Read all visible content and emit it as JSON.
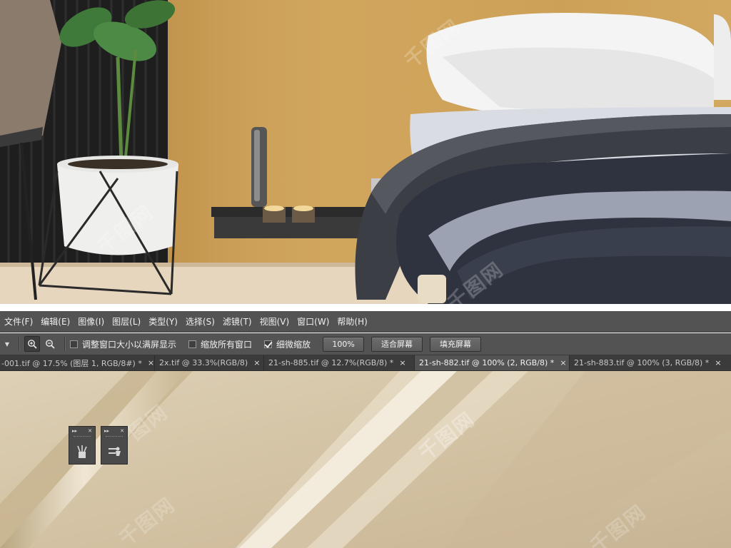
{
  "menu": [
    "文件(F)",
    "编辑(E)",
    "图像(I)",
    "图层(L)",
    "类型(Y)",
    "选择(S)",
    "滤镜(T)",
    "视图(V)",
    "窗口(W)",
    "帮助(H)"
  ],
  "options": {
    "resize_windows_label": "调整窗口大小以满屏显示",
    "resize_windows_checked": false,
    "zoom_all_label": "缩放所有窗口",
    "zoom_all_checked": false,
    "scrubby_zoom_label": "细微缩放",
    "scrubby_zoom_checked": true,
    "percent_button": "100%",
    "fit_screen_button": "适合屏幕",
    "fill_screen_button": "填充屏幕"
  },
  "tabs": [
    {
      "title": "-001.tif @ 17.5% (图层 1, RGB/8#) *",
      "active": false
    },
    {
      "title": "2x.tif @ 33.3%(RGB/8)",
      "active": false
    },
    {
      "title": "21-sh-885.tif @ 12.7%(RGB/8) *",
      "active": false
    },
    {
      "title": "21-sh-882.tif @ 100% (2, RGB/8) *",
      "active": true
    },
    {
      "title": "21-sh-883.tif @ 100% (3, RGB/8) *",
      "active": false
    }
  ],
  "tab_close_glyph": "×",
  "panels": [
    {
      "icon": "brush-presets-icon"
    },
    {
      "icon": "clone-source-icon"
    }
  ],
  "colors": {
    "ui_dark": "#535353",
    "tab_bar": "#424242",
    "fabric": "#d6c6a9"
  }
}
